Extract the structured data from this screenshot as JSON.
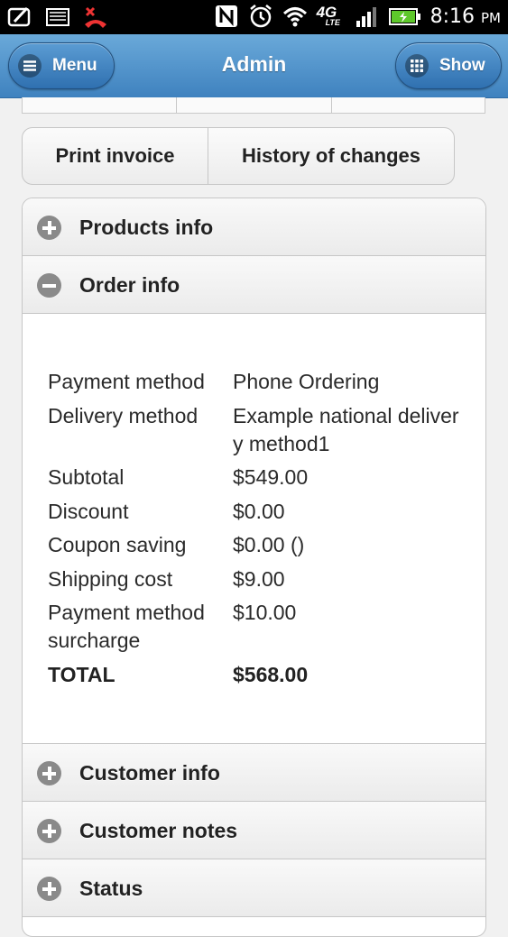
{
  "status_bar": {
    "time": "8:16",
    "ampm": "PM",
    "network_label": "4G",
    "network_sub": "LTE"
  },
  "header": {
    "title": "Admin",
    "menu_label": "Menu",
    "show_label": "Show"
  },
  "actions": {
    "print_invoice": "Print invoice",
    "history": "History of changes"
  },
  "accordion": {
    "products": "Products info",
    "order": "Order info",
    "customer": "Customer info",
    "notes": "Customer notes",
    "status": "Status"
  },
  "order_info": {
    "rows": [
      {
        "label": "Payment method",
        "value": "Phone Ordering"
      },
      {
        "label": "Delivery method",
        "value": "Example national delivery method1"
      },
      {
        "label": "Subtotal",
        "value": "$549.00"
      },
      {
        "label": "Discount",
        "value": "$0.00"
      },
      {
        "label": "Coupon saving",
        "value": "$0.00 ()"
      },
      {
        "label": "Shipping cost",
        "value": "$9.00"
      },
      {
        "label": "Payment method surcharge",
        "value": "$10.00"
      }
    ],
    "total_label": "TOTAL",
    "total_value": "$568.00"
  },
  "colors": {
    "header_top": "#6aa9d9",
    "header_bottom": "#3f82bf",
    "battery": "#5ec82b"
  }
}
